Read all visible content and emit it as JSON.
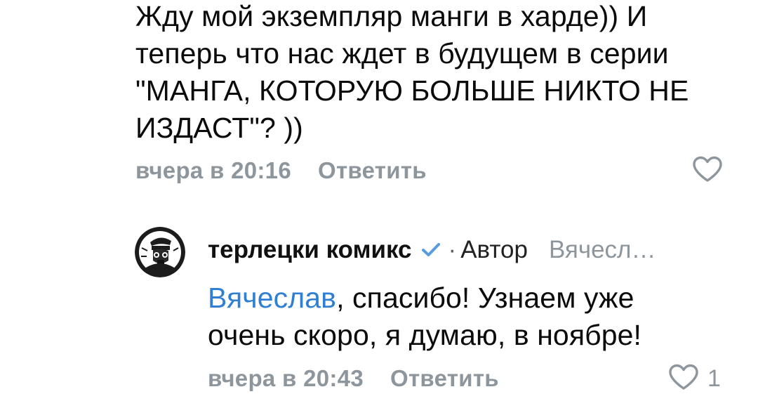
{
  "comments": [
    {
      "text_lines": [
        "Жду мой экземпляр манги в харде)) И",
        "теперь что нас ждет в будущем в серии",
        "\"МАНГА, КОТОРУЮ БОЛЬШЕ НИКТО НЕ",
        "ИЗДАСТ\"? ))"
      ],
      "time": "вчера в 20:16",
      "reply_label": "Ответить",
      "like_icon": "heart-outline-icon"
    },
    {
      "author": "терлецки комикс",
      "verified_icon": "checkmark-icon",
      "separator": "·",
      "role": "Автор",
      "reply_to": "Вячесл…",
      "mention": "Вячеслав",
      "text_rest_line1": ", спасибо! Узнаем уже",
      "text_line2": "очень скоро, я думаю, в ноябре!",
      "time": "вчера в 20:43",
      "reply_label": "Ответить",
      "like_icon": "heart-outline-icon",
      "like_count": "1"
    }
  ],
  "colors": {
    "text": "#0b0b0b",
    "meta": "#8e969d",
    "mention": "#2f7fd3",
    "verified": "#5b9be0"
  }
}
